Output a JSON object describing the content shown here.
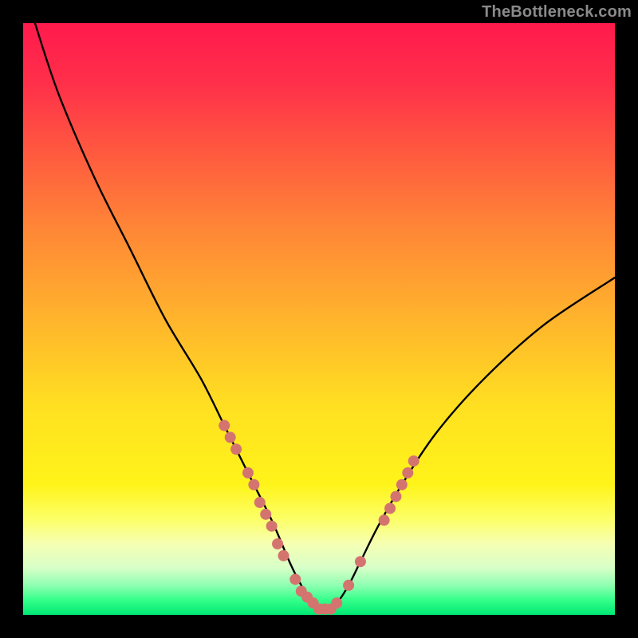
{
  "watermark": "TheBottleneck.com",
  "chart_data": {
    "type": "line",
    "title": "",
    "xlabel": "",
    "ylabel": "",
    "xlim": [
      0,
      100
    ],
    "ylim": [
      0,
      100
    ],
    "grid": false,
    "legend": false,
    "series": [
      {
        "name": "bottleneck-curve",
        "x": [
          2,
          6,
          12,
          18,
          24,
          30,
          34,
          38,
          42,
          45,
          47,
          49,
          51,
          53,
          55,
          57,
          60,
          64,
          70,
          78,
          88,
          100
        ],
        "y": [
          100,
          88,
          74,
          62,
          50,
          40,
          32,
          24,
          16,
          9,
          5,
          2,
          1,
          2,
          5,
          9,
          15,
          22,
          31,
          40,
          49,
          57
        ]
      }
    ],
    "markers": {
      "name": "highlight-points",
      "color": "#d4746f",
      "points": [
        {
          "x": 34,
          "y": 32
        },
        {
          "x": 35,
          "y": 30
        },
        {
          "x": 36,
          "y": 28
        },
        {
          "x": 38,
          "y": 24
        },
        {
          "x": 39,
          "y": 22
        },
        {
          "x": 40,
          "y": 19
        },
        {
          "x": 41,
          "y": 17
        },
        {
          "x": 42,
          "y": 15
        },
        {
          "x": 43,
          "y": 12
        },
        {
          "x": 44,
          "y": 10
        },
        {
          "x": 46,
          "y": 6
        },
        {
          "x": 47,
          "y": 4
        },
        {
          "x": 48,
          "y": 3
        },
        {
          "x": 49,
          "y": 2
        },
        {
          "x": 50,
          "y": 1
        },
        {
          "x": 51,
          "y": 1
        },
        {
          "x": 52,
          "y": 1
        },
        {
          "x": 53,
          "y": 2
        },
        {
          "x": 55,
          "y": 5
        },
        {
          "x": 57,
          "y": 9
        },
        {
          "x": 61,
          "y": 16
        },
        {
          "x": 62,
          "y": 18
        },
        {
          "x": 63,
          "y": 20
        },
        {
          "x": 64,
          "y": 22
        },
        {
          "x": 65,
          "y": 24
        },
        {
          "x": 66,
          "y": 26
        }
      ]
    },
    "gradient_stops": [
      {
        "offset": 0.0,
        "color": "#ff1a4c"
      },
      {
        "offset": 0.1,
        "color": "#ff2f4a"
      },
      {
        "offset": 0.22,
        "color": "#ff5a3f"
      },
      {
        "offset": 0.35,
        "color": "#ff8736"
      },
      {
        "offset": 0.5,
        "color": "#ffb42c"
      },
      {
        "offset": 0.65,
        "color": "#ffe021"
      },
      {
        "offset": 0.78,
        "color": "#fff41a"
      },
      {
        "offset": 0.84,
        "color": "#fcff6a"
      },
      {
        "offset": 0.88,
        "color": "#f6ffb3"
      },
      {
        "offset": 0.92,
        "color": "#d8ffc8"
      },
      {
        "offset": 0.95,
        "color": "#8fffb1"
      },
      {
        "offset": 0.975,
        "color": "#34ff8a"
      },
      {
        "offset": 1.0,
        "color": "#00e874"
      }
    ]
  }
}
